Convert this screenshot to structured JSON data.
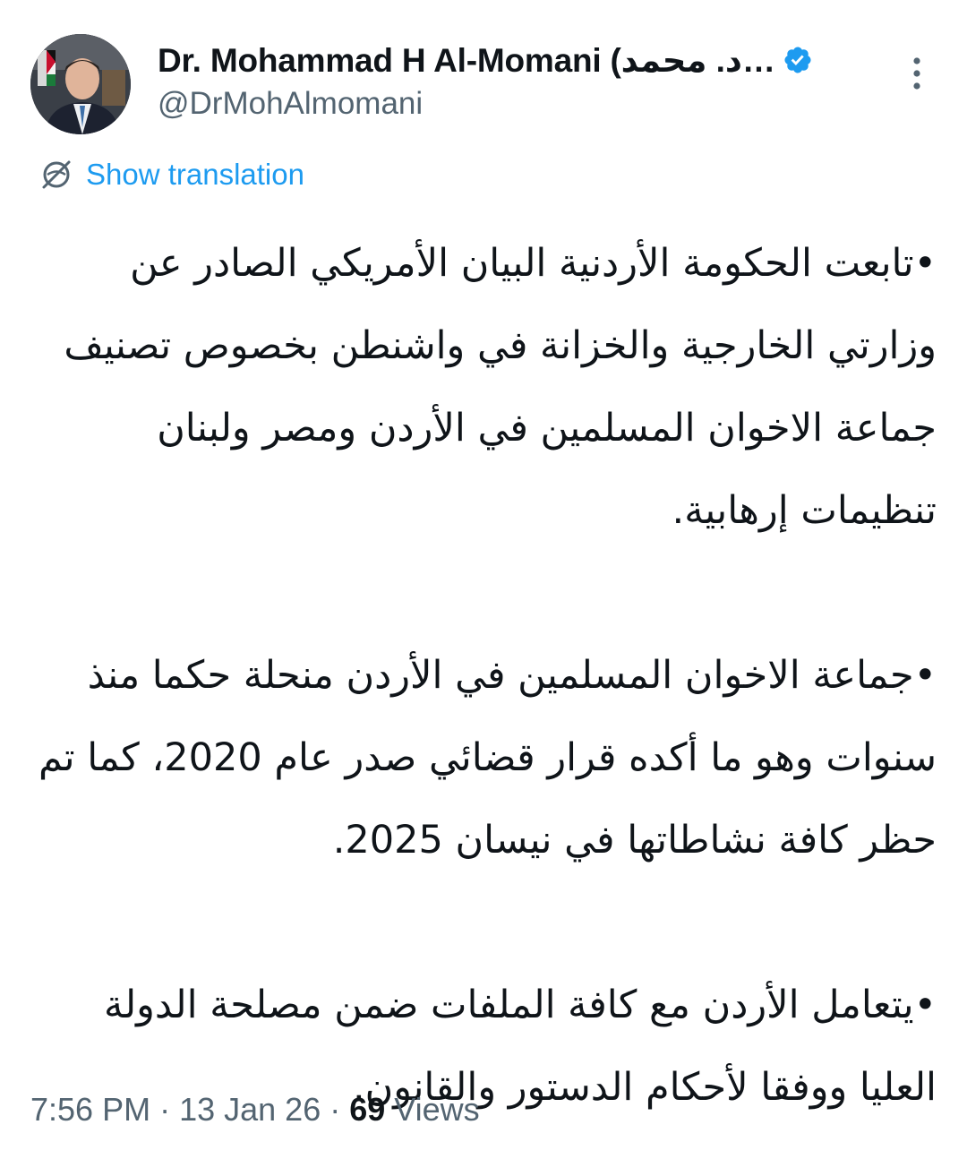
{
  "author": {
    "display_name": "Dr. Mohammad H Al-Momani (د. محمد…",
    "handle": "@DrMohAlmomani",
    "verified": true
  },
  "icons": {
    "verified": "verified-badge-icon",
    "more": "more-options-icon",
    "translate": "globe-translate-icon",
    "avatar": "profile-photo"
  },
  "colors": {
    "accent": "#1d9bf0",
    "text": "#0f1419",
    "secondary": "#536471"
  },
  "translation": {
    "label": "Show translation"
  },
  "tweet": {
    "paragraphs": [
      "•تابعت الحكومة الأردنية البيان الأمريكي الصادر عن وزارتي الخارجية والخزانة في واشنطن بخصوص تصنيف جماعة الاخوان المسلمين في الأردن ومصر ولبنان تنظيمات إرهابية.",
      "•جماعة الاخوان المسلمين في الأردن منحلة حكما منذ سنوات وهو ما أكده قرار قضائي صدر عام 2020، كما تم حظر كافة نشاطاتها في نيسان 2025.",
      "•يتعامل الأردن مع كافة الملفات ضمن مصلحة الدولة العليا ووفقا لأحكام الدستور والقانون."
    ]
  },
  "meta": {
    "time": "7:56 PM",
    "separator": "·",
    "date": "13 Jan 26",
    "views_count": "69",
    "views_label": "Views"
  }
}
